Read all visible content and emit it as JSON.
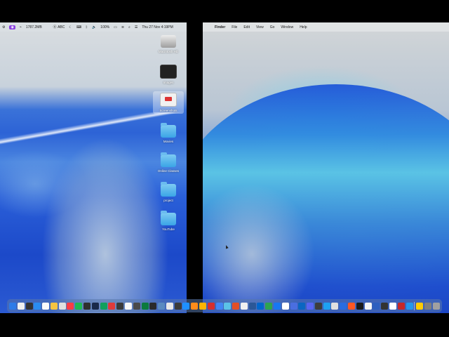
{
  "left_menubar": {
    "app_pill": "◉",
    "memory": "1787.2MB",
    "input_source": "ABC",
    "battery": "100%",
    "datetime": "Thu 27 Nov  4:19PM"
  },
  "right_menubar": {
    "apple": "",
    "app_name": "Finder",
    "menus": [
      "File",
      "Edit",
      "View",
      "Go",
      "Window",
      "Help"
    ]
  },
  "desktop_icons": [
    {
      "label": "Macintosh HD",
      "icon": "drive-icon"
    },
    {
      "label": "Images",
      "icon": "images-icon"
    },
    {
      "label": "Screenshots",
      "icon": "screenshot-icon"
    },
    {
      "label": "Movies",
      "icon": "folder-icon"
    },
    {
      "label": "Online Classes",
      "icon": "folder-icon"
    },
    {
      "label": "project",
      "icon": "folder-icon"
    },
    {
      "label": "YouTube",
      "icon": "folder-icon"
    }
  ],
  "dock_colors": [
    "#2d7be8",
    "#f0f0f0",
    "#333",
    "#2a8cf0",
    "#fafafa",
    "#f5c542",
    "#e0e0e0",
    "#fc3c44",
    "#1db954",
    "#2f2f2f",
    "#1a2a4a",
    "#12a05c",
    "#e03a3a",
    "#3a3a3a",
    "#f7f7f7",
    "#4a4a4a",
    "#0b7a3e",
    "#2a2a2a",
    "#5a8ac0",
    "#e8e8e8",
    "#3b3b3b",
    "#1e90ff",
    "#ff8c1a",
    "#ffb300",
    "#d62e2e",
    "#4285f4",
    "#5bc2e7",
    "#e34f26",
    "#f0f0f0",
    "#2b5797",
    "#0066cc",
    "#2ea44f",
    "#1877f2",
    "#ffffff",
    "#4a6ee0",
    "#0a66c2",
    "#5865f2",
    "#3d3d3d",
    "#1da1f2",
    "#e0e0e0",
    "#2a6ce0",
    "#ff5722",
    "#1a1a1a",
    "#f4f4f4",
    "#2e5fbf",
    "#333",
    "#ffffff",
    "#c62828",
    "#2496ed",
    "#ffcc00",
    "#7f7f7f",
    "#a0a0a0"
  ]
}
